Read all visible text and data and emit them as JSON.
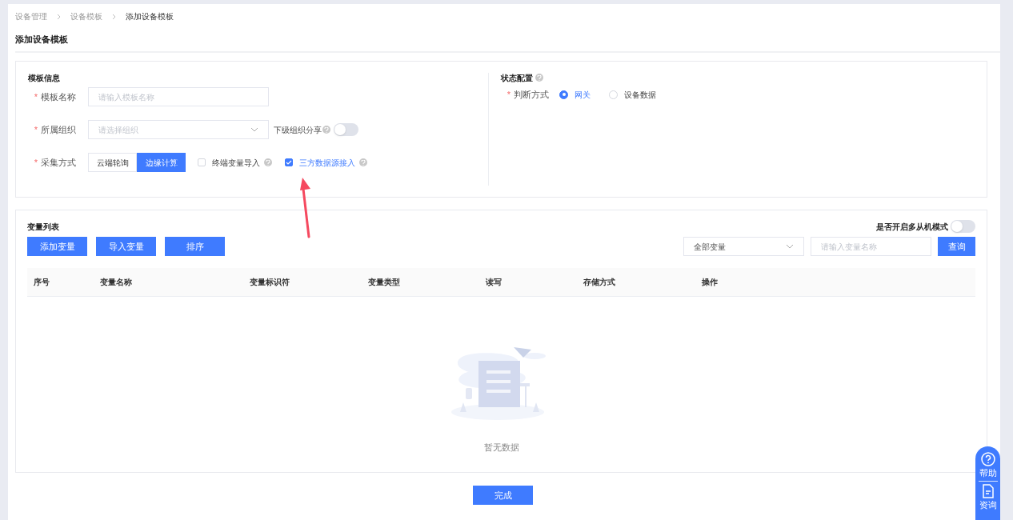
{
  "breadcrumb": [
    "设备管理",
    "设备模板",
    "添加设备模板"
  ],
  "page_title": "添加设备模板",
  "template_info": {
    "title": "模板信息",
    "name_field": {
      "label": "模板名称",
      "required_mark": "*",
      "placeholder": "请输入模板名称"
    },
    "org_field": {
      "label": "所属组织",
      "required_mark": "*",
      "placeholder": "请选择组织"
    },
    "sub_org_share": {
      "label": "下级组织分享",
      "on": false
    },
    "collect_mode": {
      "label": "采集方式",
      "required_mark": "*",
      "options": [
        {
          "label": "云端轮询",
          "selected": false
        },
        {
          "label": "边缘计算",
          "selected": true
        }
      ]
    },
    "checkboxes": [
      {
        "label": "终端变量导入",
        "checked": false
      },
      {
        "label": "三方数据源接入",
        "checked": true
      }
    ]
  },
  "status_config": {
    "title": "状态配置",
    "judge": {
      "label": "判断方式",
      "required_mark": "*",
      "options": [
        {
          "label": "网关",
          "selected": true
        },
        {
          "label": "设备数据",
          "selected": false
        }
      ]
    }
  },
  "variables": {
    "title": "变量列表",
    "buttons": [
      "添加变量",
      "导入变量",
      "排序"
    ],
    "multi_slave": {
      "label": "是否开启多从机模式",
      "on": false
    },
    "filter": {
      "value": "全部变量"
    },
    "search": {
      "placeholder": "请输入变量名称"
    },
    "query_button": "查询",
    "columns": [
      "序号",
      "变量名称",
      "变量标识符",
      "变量类型",
      "读写",
      "存储方式",
      "操作"
    ],
    "empty_text": "暂无数据"
  },
  "finish_button": "完成",
  "help_widget": [
    {
      "kind": "help",
      "label": "帮助"
    },
    {
      "kind": "doc",
      "label": "资询"
    }
  ]
}
